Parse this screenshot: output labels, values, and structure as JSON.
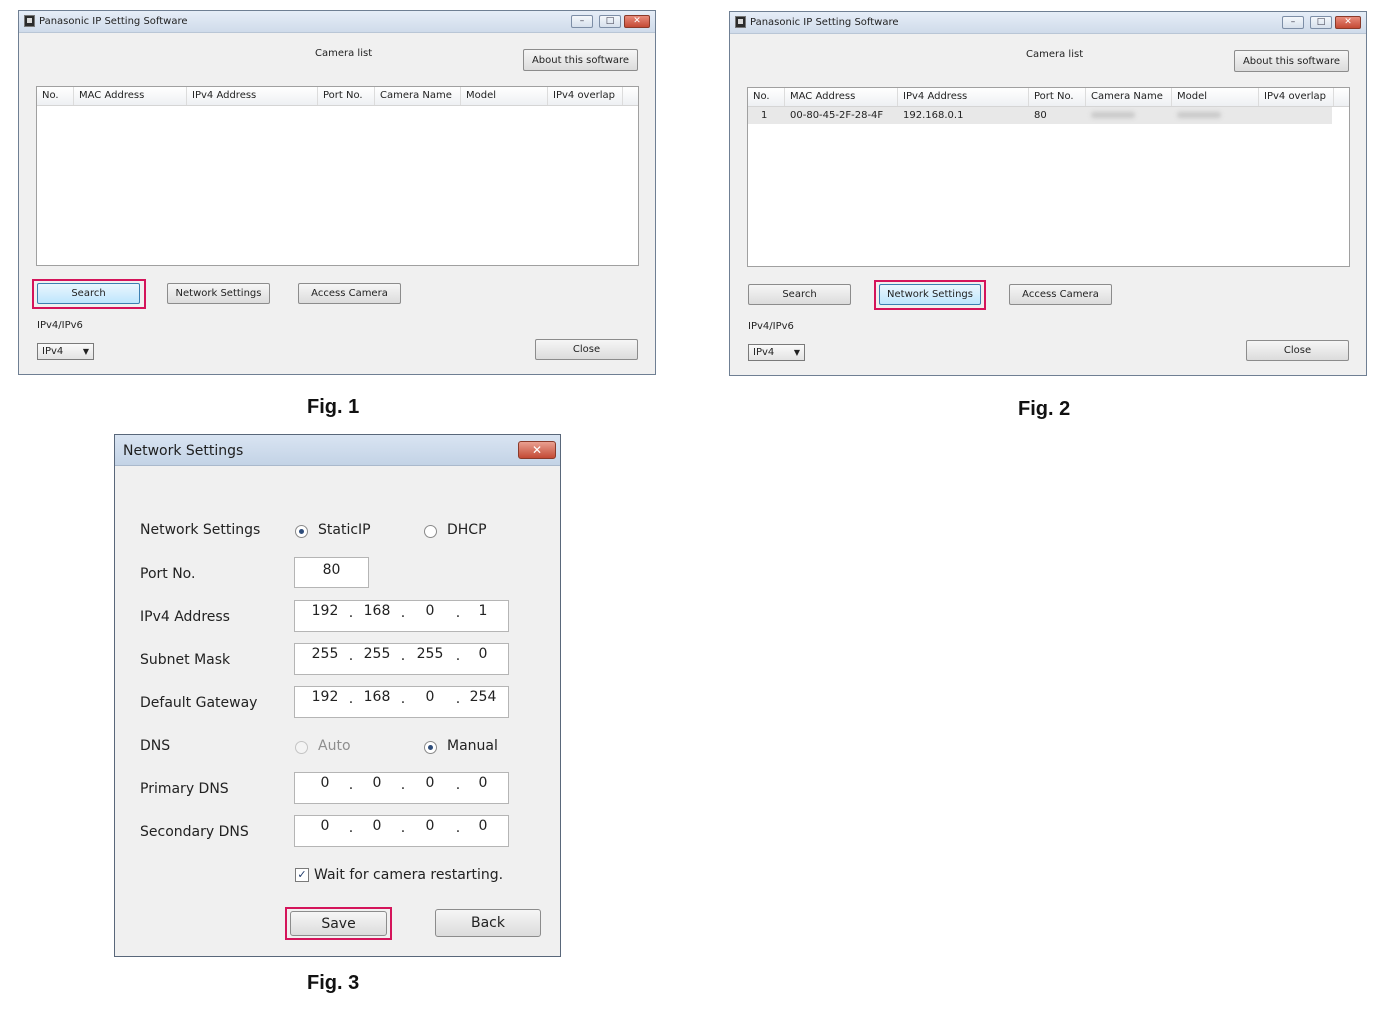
{
  "window": {
    "title": "Panasonic IP Setting Software",
    "heading": "Camera list",
    "about_button": "About this software",
    "minimize_glyph": "–",
    "maximize_glyph": "□",
    "close_glyph": "✕"
  },
  "columns": [
    "No.",
    "MAC Address",
    "IPv4 Address",
    "Port No.",
    "Camera Name",
    "Model",
    "IPv4 overlap"
  ],
  "rows": [
    {
      "no": "1",
      "mac": "00-80-45-2F-28-4F",
      "ipv4": "192.168.0.1",
      "port": "80"
    }
  ],
  "buttons": {
    "search": "Search",
    "network_settings": "Network Settings",
    "access_camera": "Access Camera",
    "close": "Close"
  },
  "ip_version": {
    "label": "IPv4/IPv6",
    "selected": "IPv4"
  },
  "figures": {
    "fig1": "Fig. 1",
    "fig2": "Fig. 2",
    "fig3": "Fig. 3"
  },
  "dialog": {
    "title": "Network Settings",
    "close_glyph": "✕",
    "network_settings_label": "Network Settings",
    "static_ip": "StaticIP",
    "dhcp": "DHCP",
    "port_label": "Port No.",
    "port_value": "80",
    "ipv4_label": "IPv4 Address",
    "ipv4": [
      "192",
      "168",
      "0",
      "1"
    ],
    "subnet_label": "Subnet Mask",
    "subnet": [
      "255",
      "255",
      "255",
      "0"
    ],
    "gateway_label": "Default Gateway",
    "gateway": [
      "192",
      "168",
      "0",
      "254"
    ],
    "dns_label": "DNS",
    "dns_auto": "Auto",
    "dns_manual": "Manual",
    "primary_dns_label": "Primary DNS",
    "primary_dns": [
      "0",
      "0",
      "0",
      "0"
    ],
    "secondary_dns_label": "Secondary DNS",
    "secondary_dns": [
      "0",
      "0",
      "0",
      "0"
    ],
    "wait_label": "Wait for camera restarting.",
    "check_glyph": "✓",
    "save": "Save",
    "back": "Back"
  },
  "colors": {
    "highlight": "#d4145a",
    "titlebar": "#cfdbea"
  },
  "icons": {
    "app": "app-icon",
    "dropdown": "chevron-down-icon",
    "close": "close-icon"
  }
}
